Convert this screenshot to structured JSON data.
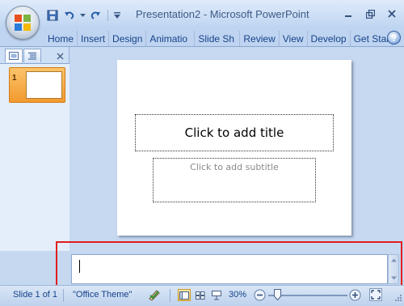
{
  "window": {
    "title": "Presentation2 - Microsoft PowerPoint"
  },
  "quick_access": {
    "buttons": [
      "save-icon",
      "undo-icon",
      "undo-dropdown-icon",
      "redo-icon",
      "customize-dropdown-icon"
    ]
  },
  "ribbon": {
    "tabs": [
      "Home",
      "Insert",
      "Design",
      "Animatio",
      "Slide Sh",
      "Review",
      "View",
      "Develop",
      "Get Star"
    ],
    "help_label": "?"
  },
  "slide": {
    "title_placeholder": "Click to add title",
    "subtitle_placeholder": "Click to add subtitle"
  },
  "thumbnails": [
    {
      "number": "1"
    }
  ],
  "status": {
    "slide_info": "Slide 1 of 1",
    "theme": "\"Office Theme\"",
    "zoom": "30%"
  },
  "colors": {
    "highlight": "#e01e1e",
    "accent": "#15428b",
    "selected_thumbnail": "#f29a2e"
  }
}
